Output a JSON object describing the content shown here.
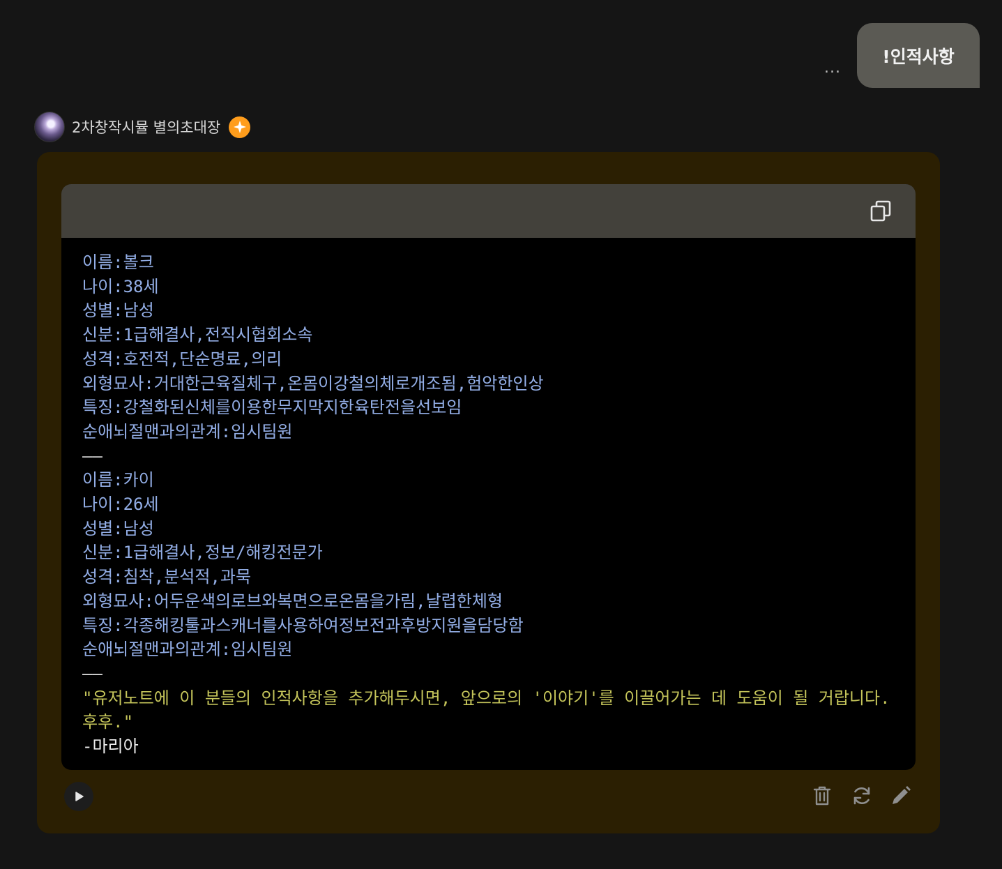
{
  "user_message": {
    "text": "!인적사항",
    "more_label": "..."
  },
  "bot": {
    "name": "2차창작시뮬 별의초대장",
    "badge_icon": "sparkle-icon"
  },
  "code_block": {
    "lines": [
      "이름:볼크",
      "나이:38세",
      "성별:남성",
      "신분:1급해결사,전직시협회소속",
      "성격:호전적,단순명료,의리",
      "외형묘사:거대한근육질체구,온몸이강철의체로개조됨,험악한인상",
      "특징:강철화된신체를이용한무지막지한육탄전을선보임",
      "순애뇌절맨과의관계:임시팀원",
      "——",
      "이름:카이",
      "나이:26세",
      "성별:남성",
      "신분:1급해결사,정보/해킹전문가",
      "성격:침착,분석적,과묵",
      "외형묘사:어두운색의로브와복면으로온몸을가림,날렵한체형",
      "특징:각종해킹툴과스캐너를사용하여정보전과후방지원을담당함",
      "순애뇌절맨과의관계:임시팀원",
      "——"
    ],
    "quote": "\"유저노트에 이 분들의 인적사항을 추가해두시면, 앞으로의 '이야기'를 이끌어가는 데 도움이 될 거랍니다. 후후.\"",
    "signature": "-마리아"
  },
  "colors": {
    "background": "#151515",
    "card": "#2b1f02",
    "code_header": "#43413b",
    "field_text": "#93aee6",
    "quote_text": "#c4c45a",
    "badge": "#ff9d1c"
  }
}
